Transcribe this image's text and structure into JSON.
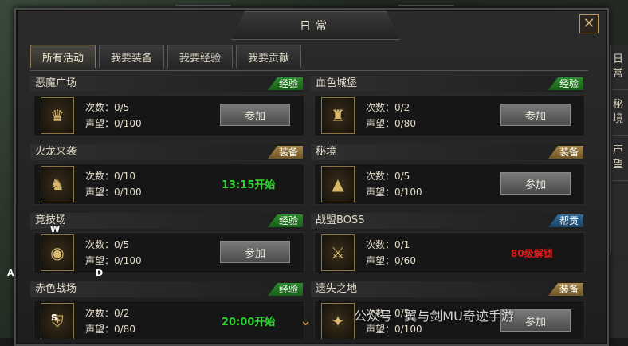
{
  "window": {
    "title": "日常",
    "close_glyph": "✕"
  },
  "tabs": [
    {
      "label": "所有活动"
    },
    {
      "label": "我要装备"
    },
    {
      "label": "我要经验"
    },
    {
      "label": "我要贡献"
    }
  ],
  "activities": [
    {
      "name": "恶魔广场",
      "tag": "经验",
      "count": "次数：0/5",
      "rep": "声望：0/100",
      "action": "参加",
      "icon": "skull-icon"
    },
    {
      "name": "血色城堡",
      "tag": "经验",
      "count": "次数：0/2",
      "rep": "声望：0/80",
      "action": "参加",
      "icon": "castle-icon"
    },
    {
      "name": "火龙来袭",
      "tag": "装备",
      "count": "次数：0/10",
      "rep": "声望：0/100",
      "timer": "13:15开始",
      "icon": "dragon-icon"
    },
    {
      "name": "秘境",
      "tag": "装备",
      "count": "次数：0/5",
      "rep": "声望：0/100",
      "action": "参加",
      "icon": "portal-icon"
    },
    {
      "name": "竞技场",
      "tag": "经验",
      "count": "次数：0/5",
      "rep": "声望：0/100",
      "action": "参加",
      "icon": "arena-icon"
    },
    {
      "name": "战盟BOSS",
      "tag": "帮贡",
      "count": "次数：0/1",
      "rep": "声望：0/60",
      "locked": "80级解锁",
      "icon": "boss-icon"
    },
    {
      "name": "赤色战场",
      "tag": "经验",
      "count": "次数：0/2",
      "rep": "声望：0/80",
      "timer": "20:00开始",
      "icon": "battlefield-icon"
    },
    {
      "name": "遗失之地",
      "tag": "装备",
      "count": "次数：0/5",
      "rep": "声望：0/100",
      "action": "参加",
      "icon": "lost-land-icon"
    }
  ],
  "side": [
    "日常",
    "秘境",
    "声望"
  ],
  "overlay": {
    "letters": [
      "W",
      "A",
      "D",
      "S"
    ],
    "watermark": "公众号 · 翼与剑MU奇迹手游"
  },
  "colors": {
    "exp_tag": "#2c8a2c",
    "equip_tag": "#a8884a",
    "help_tag": "#2f6b9b",
    "timer": "#2fd42f",
    "locked": "#e01a1a"
  }
}
